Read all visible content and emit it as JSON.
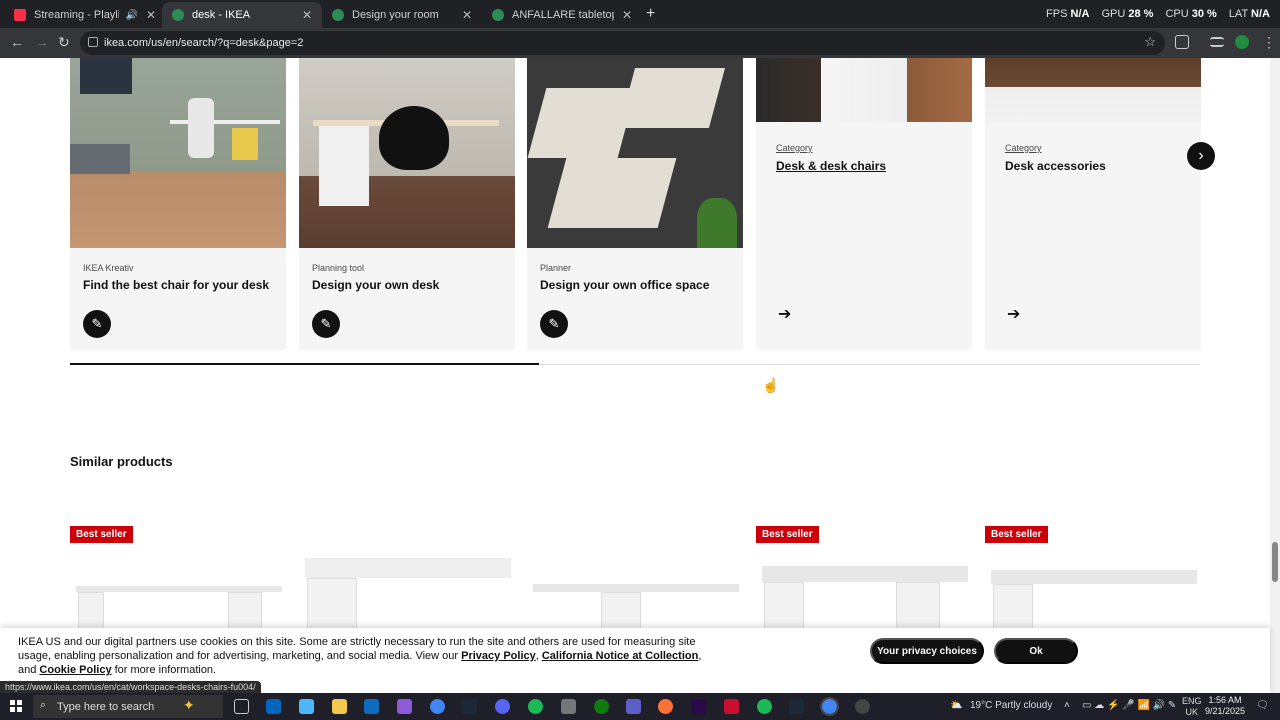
{
  "tabs": [
    {
      "title": "Streaming - Playlist - Apple",
      "color": "#fa2d48"
    },
    {
      "title": "desk - IKEA",
      "color": "#2e8b57"
    },
    {
      "title": "Design your room",
      "color": "#2e8b57"
    },
    {
      "title": "ANFALLARE tabletop, bamboo",
      "color": "#2e8b57"
    }
  ],
  "perf": {
    "fps_label": "FPS",
    "fps_value": "N/A",
    "gpu_label": "GPU",
    "gpu_value": "28 %",
    "cpu_label": "CPU",
    "cpu_value": "30 %",
    "lat_label": "LAT",
    "lat_value": "N/A"
  },
  "address": {
    "url": "ikea.com/us/en/search/?q=desk&page=2"
  },
  "cards": [
    {
      "kicker": "IKEA Kreativ",
      "title": "Find the best chair for your desk"
    },
    {
      "kicker": "Planning tool",
      "title": "Design your own desk"
    },
    {
      "kicker": "Planner",
      "title": "Design your own office space"
    }
  ],
  "categories": [
    {
      "kicker": "Category",
      "title": "Desk & desk chairs"
    },
    {
      "kicker": "Category",
      "title": "Desk accessories"
    }
  ],
  "carousel_progress": 0.415,
  "similar": {
    "title": "Similar products",
    "badge": "Best seller"
  },
  "cookie": {
    "text1": "IKEA US and our digital partners use cookies on this site. Some are strictly necessary to run the site and others are used for measuring site usage, enabling personalization and for advertising, marketing, and social media. View our",
    "link1": "Privacy Policy",
    "sep1": ",",
    "link2": "California Notice at Collection",
    "sep2": ", and",
    "link3": "Cookie Policy",
    "text2": "for more information.",
    "privacy_btn": "Your privacy choices",
    "ok_btn": "Ok"
  },
  "status_url": "https://www.ikea.com/us/en/cat/workspace-desks-chairs-fu004/",
  "taskbar": {
    "search_placeholder": "Type here to search",
    "weather": "19°C  Partly cloudy",
    "lang1": "ENG",
    "lang2": "UK",
    "time": "1:56 AM",
    "date": "9/21/2025"
  }
}
